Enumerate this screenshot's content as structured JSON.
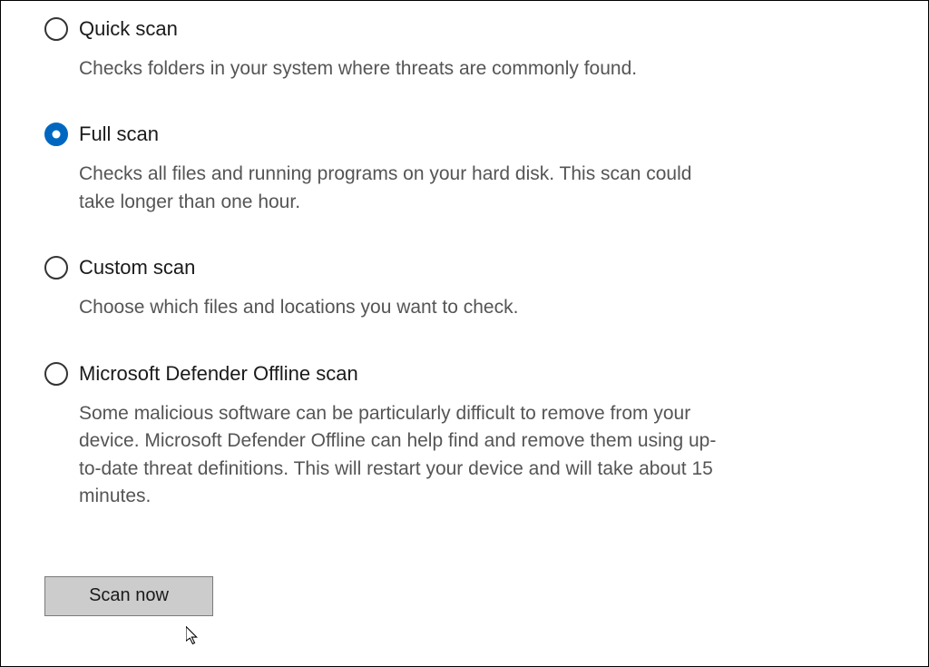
{
  "options": [
    {
      "id": "quick",
      "title": "Quick scan",
      "description": "Checks folders in your system where threats are commonly found.",
      "selected": false
    },
    {
      "id": "full",
      "title": "Full scan",
      "description": "Checks all files and running programs on your hard disk. This scan could take longer than one hour.",
      "selected": true
    },
    {
      "id": "custom",
      "title": "Custom scan",
      "description": "Choose which files and locations you want to check.",
      "selected": false
    },
    {
      "id": "offline",
      "title": "Microsoft Defender Offline scan",
      "description": "Some malicious software can be particularly difficult to remove from your device. Microsoft Defender Offline can help find and remove them using up-to-date threat definitions. This will restart your device and will take about 15 minutes.",
      "selected": false
    }
  ],
  "button": {
    "scan_now": "Scan now"
  }
}
